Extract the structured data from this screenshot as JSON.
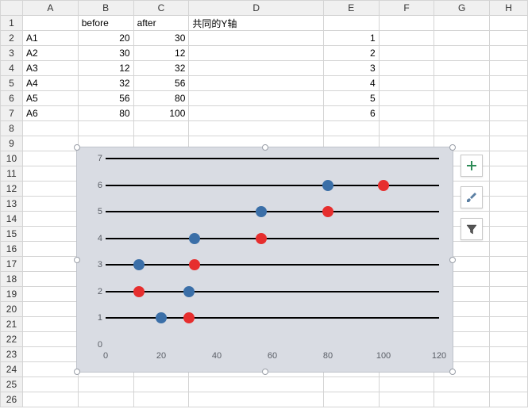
{
  "columns": [
    "A",
    "B",
    "C",
    "D",
    "E",
    "F",
    "G",
    "H"
  ],
  "row_count": 26,
  "headers": {
    "B1": "before",
    "C1": "after",
    "D1": "共同的Y轴"
  },
  "rows": [
    {
      "A": "A1",
      "B": 20,
      "C": 30,
      "E": 1
    },
    {
      "A": "A2",
      "B": 30,
      "C": 12,
      "E": 2
    },
    {
      "A": "A3",
      "B": 12,
      "C": 32,
      "E": 3
    },
    {
      "A": "A4",
      "B": 32,
      "C": 56,
      "E": 4
    },
    {
      "A": "A5",
      "B": 56,
      "C": 80,
      "E": 5
    },
    {
      "A": "A6",
      "B": 80,
      "C": 100,
      "E": 6
    }
  ],
  "chart_data": {
    "type": "scatter",
    "x": [
      0,
      1,
      2,
      3,
      4,
      5,
      6,
      7
    ],
    "xlim": [
      0,
      120
    ],
    "ylim": [
      0,
      7
    ],
    "xticks": [
      0,
      20,
      40,
      60,
      80,
      100,
      120
    ],
    "yticks": [
      0,
      1,
      2,
      3,
      4,
      5,
      6,
      7
    ],
    "hlines_y": [
      1,
      2,
      3,
      4,
      5,
      6,
      7
    ],
    "series": [
      {
        "name": "before",
        "color": "#3b6fa8",
        "points": [
          [
            20,
            1
          ],
          [
            30,
            2
          ],
          [
            12,
            3
          ],
          [
            32,
            4
          ],
          [
            56,
            5
          ],
          [
            80,
            6
          ]
        ]
      },
      {
        "name": "after",
        "color": "#e62e2e",
        "points": [
          [
            30,
            1
          ],
          [
            12,
            2
          ],
          [
            32,
            3
          ],
          [
            56,
            4
          ],
          [
            80,
            5
          ],
          [
            100,
            6
          ]
        ]
      }
    ]
  },
  "side_buttons": {
    "add": "+",
    "brush": "brush",
    "filter": "filter"
  }
}
